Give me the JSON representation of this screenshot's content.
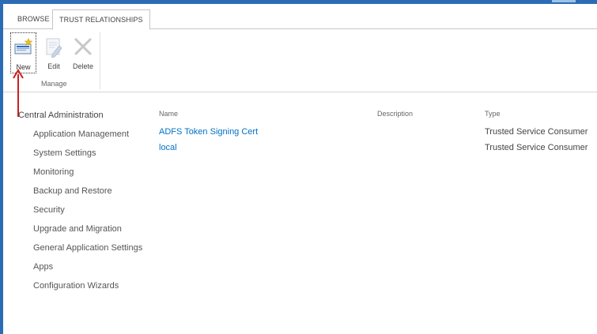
{
  "ribbon": {
    "tabs": [
      {
        "label": "BROWSE"
      },
      {
        "label": "TRUST RELATIONSHIPS"
      }
    ],
    "buttons": {
      "new": "New",
      "edit": "Edit",
      "delete": "Delete"
    },
    "group_label": "Manage"
  },
  "nav": {
    "root": "Central Administration",
    "items": [
      {
        "label": "Application Management"
      },
      {
        "label": "System Settings"
      },
      {
        "label": "Monitoring"
      },
      {
        "label": "Backup and Restore"
      },
      {
        "label": "Security"
      },
      {
        "label": "Upgrade and Migration"
      },
      {
        "label": "General Application Settings"
      },
      {
        "label": "Apps"
      },
      {
        "label": "Configuration Wizards"
      }
    ]
  },
  "table": {
    "headers": {
      "name": "Name",
      "description": "Description",
      "type": "Type"
    },
    "rows": [
      {
        "name": "ADFS Token Signing Cert",
        "description": "",
        "type": "Trusted Service Consumer"
      },
      {
        "name": "local",
        "description": "",
        "type": "Trusted Service Consumer"
      }
    ]
  },
  "colors": {
    "frame": "#2b6cb5",
    "link": "#0072c6",
    "annotation_arrow": "#cc1f1f"
  },
  "icons": {
    "new": "new-document-icon",
    "edit": "edit-document-icon",
    "delete": "delete-x-icon"
  }
}
